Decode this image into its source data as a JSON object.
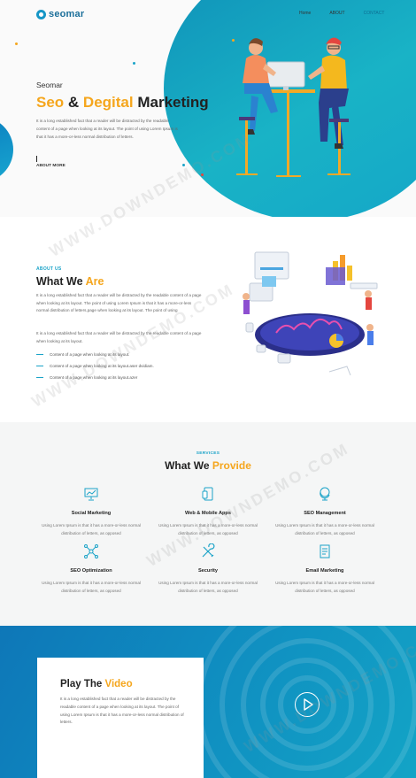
{
  "logo": {
    "text": "seomar",
    "icon": "logo-mark-icon"
  },
  "nav": {
    "items": [
      "Home",
      "ABOUT",
      "CONTACT"
    ]
  },
  "hero": {
    "brand": "Seomar",
    "title_part1": "Seo",
    "title_amp": " & ",
    "title_part2": "Degital",
    "title_part3": " Marketing",
    "text": "It is a long established fact that a reader will be distracted by the readable content of a page when looking at its layout. The point of using Lorem Ipsum is that it has a more-or-less normal distribution of letters.",
    "more": "ABOUT MORE"
  },
  "about": {
    "kicker": "ABOUT US",
    "title_part1": "What We ",
    "title_part2": "Are",
    "p1": "It is a long established fact that a reader will be distracted by the readable content of a page when looking at its layout. The point of using Lorem Ipsum is that it has a more-or-less normal distribution of letters,page when looking at its layout. The point of using",
    "p2": "It is a long established fact that a reader will be distracted by the readable content of a page when looking at its layout.",
    "list": [
      "Content of a page when looking at its layout.",
      "Content of a page when looking at its layout.aser dvidiam.",
      "Content of a page when looking at its layout.azer"
    ]
  },
  "services": {
    "kicker": "SERVICES",
    "title_part1": "What We ",
    "title_part2": "Provide",
    "items": [
      {
        "name": "Social Marketing",
        "desc": "Using Lorem Ipsum is that it has a more-or-less normal distribution of letters, as opposed",
        "icon": "presentation-chart-icon"
      },
      {
        "name": "Web & Mobile Apps",
        "desc": "Using Lorem Ipsum is that it has a more-or-less normal distribution of letters, as opposed",
        "icon": "mobile-devices-icon"
      },
      {
        "name": "SEO Management",
        "desc": "Using Lorem Ipsum is that it has a more-or-less normal distribution of letters, as opposed",
        "icon": "globe-stand-icon"
      },
      {
        "name": "SEO Optimization",
        "desc": "Using Lorem Ipsum is that it has a more-or-less normal distribution of letters, as opposed",
        "icon": "network-icon"
      },
      {
        "name": "Security",
        "desc": "Using Lorem Ipsum is that it has a more-or-less normal distribution of letters, as opposed",
        "icon": "tools-icon"
      },
      {
        "name": "Email Marketing",
        "desc": "Using Lorem Ipsum is that it has a more-or-less normal distribution of letters, as opposed",
        "icon": "email-document-icon"
      }
    ]
  },
  "video": {
    "title_part1": "Play The ",
    "title_part2": "Video",
    "text": "It is a long established fact that a reader will be distracted by the readable content of a page when looking at its layout. The point of using Lorem Ipsum is that it has a more-or-less normal distribution of letters."
  },
  "watermark": "WWW.DOWNDEMO.COM",
  "colors": {
    "accent": "#f5a61d",
    "primary": "#1696c6",
    "dark": "#222222"
  }
}
